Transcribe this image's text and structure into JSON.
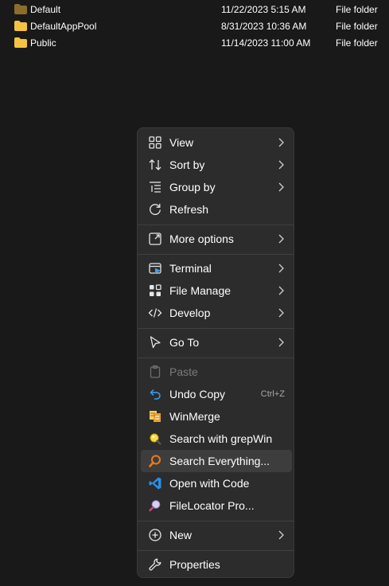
{
  "files": [
    {
      "name": "Default",
      "date": "11/22/2023 5:15 AM",
      "type": "File folder",
      "dim": true
    },
    {
      "name": "DefaultAppPool",
      "date": "8/31/2023 10:36 AM",
      "type": "File folder",
      "dim": false
    },
    {
      "name": "Public",
      "date": "11/14/2023 11:00 AM",
      "type": "File folder",
      "dim": false
    }
  ],
  "menu": {
    "view": "View",
    "sort_by": "Sort by",
    "group_by": "Group by",
    "refresh": "Refresh",
    "more_options": "More options",
    "terminal": "Terminal",
    "file_manage": "File Manage",
    "develop": "Develop",
    "go_to": "Go To",
    "paste": "Paste",
    "undo_copy": "Undo Copy",
    "undo_copy_shortcut": "Ctrl+Z",
    "winmerge": "WinMerge",
    "search_grepwin": "Search with grepWin",
    "search_everything": "Search Everything...",
    "open_with_code": "Open with Code",
    "filelocator": "FileLocator Pro...",
    "new": "New",
    "properties": "Properties"
  },
  "colors": {
    "background": "#191919",
    "menu_background": "#2c2c2c",
    "hover": "#3d3d3d",
    "folder": "#f5c242",
    "accent_blue": "#3aa0f3"
  }
}
